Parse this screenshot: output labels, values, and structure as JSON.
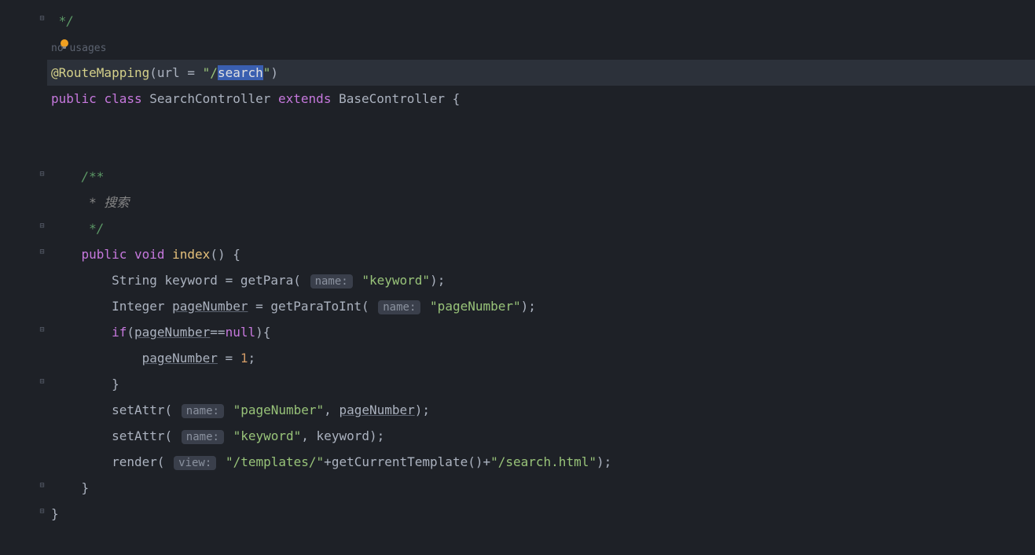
{
  "code": {
    "line1": "*/",
    "usages_hint": "no usages",
    "annotation_name": "@RouteMapping",
    "annotation_param": "url = ",
    "url_prefix": "\"/",
    "url_value": "search",
    "url_suffix": "\"",
    "public_kw": "public",
    "class_kw": "class",
    "class_name": "SearchController",
    "extends_kw": "extends",
    "base_class": "BaseController",
    "open_brace": "{",
    "doc_start": "/**",
    "doc_line": " * 搜索",
    "doc_end": " */",
    "void_kw": "void",
    "method_name": "index",
    "method_params": "()",
    "string_type": "String",
    "keyword_var": "keyword",
    "equals": " = ",
    "getPara": "getPara",
    "hint_name": "name:",
    "keyword_str": "\"keyword\"",
    "integer_type": "Integer",
    "pageNumber_var": "pageNumber",
    "getParaToInt": "getParaToInt",
    "pageNumber_str": "\"pageNumber\"",
    "if_kw": "if",
    "null_kw": "null",
    "eq_op": "==",
    "one": "1",
    "close_brace": "}",
    "setAttr": "setAttr",
    "render": "render",
    "hint_view": "view:",
    "templates_str": "\"/templates/\"",
    "plus": "+",
    "getCurrentTemplate": "getCurrentTemplate",
    "search_html_str": "\"/search.html\"",
    "comma": ", ",
    "semicolon": ";",
    "paren_open": "(",
    "paren_close": ")"
  }
}
